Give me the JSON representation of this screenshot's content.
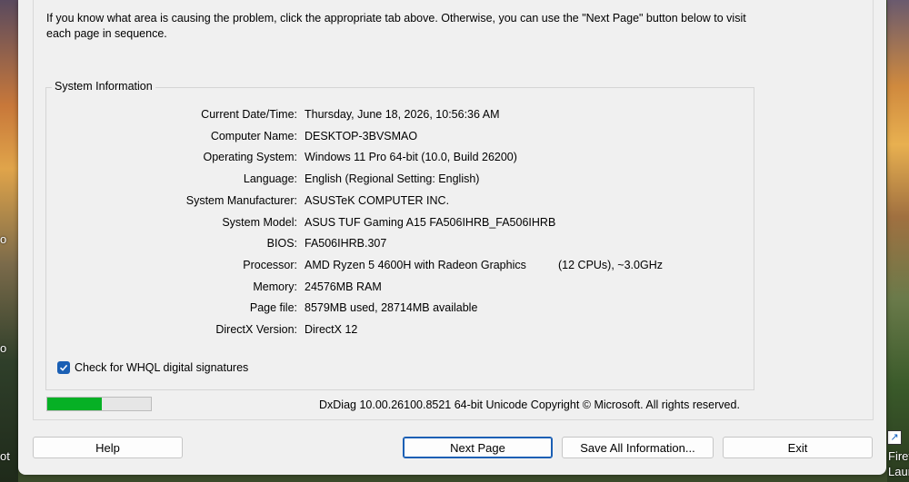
{
  "intro_text": "If you know what area is causing the problem, click the appropriate tab above.  Otherwise, you can use the \"Next Page\" button below to visit each page in sequence.",
  "system_info": {
    "title": "System Information",
    "rows": [
      {
        "label": "Current Date/Time:",
        "value": "Thursday, June 18, 2026, 10:56:36 AM"
      },
      {
        "label": "Computer Name:",
        "value": "DESKTOP-3BVSMAO"
      },
      {
        "label": "Operating System:",
        "value": "Windows 11 Pro 64-bit (10.0, Build 26200)"
      },
      {
        "label": "Language:",
        "value": "English (Regional Setting: English)"
      },
      {
        "label": "System Manufacturer:",
        "value": "ASUSTeK COMPUTER INC."
      },
      {
        "label": "System Model:",
        "value": "ASUS TUF Gaming A15 FA506IHRB_FA506IHRB"
      },
      {
        "label": "BIOS:",
        "value": "FA506IHRB.307"
      },
      {
        "label": "Processor:",
        "value": "AMD Ryzen 5 4600H with Radeon Graphics",
        "value2": "(12 CPUs), ~3.0GHz"
      },
      {
        "label": "Memory:",
        "value": "24576MB RAM"
      },
      {
        "label": "Page file:",
        "value": "8579MB used, 28714MB available"
      },
      {
        "label": "DirectX Version:",
        "value": "DirectX 12"
      }
    ]
  },
  "whql_checkbox": {
    "label": "Check for WHQL digital signatures",
    "checked": true
  },
  "progress": {
    "fraction": 0.53,
    "color": "#06b025"
  },
  "copyright": "DxDiag 10.00.26100.8521 64-bit Unicode  Copyright © Microsoft. All rights reserved.",
  "buttons": {
    "help": "Help",
    "next_page": "Next Page",
    "save_all": "Save All Information...",
    "exit": "Exit"
  },
  "desktop": {
    "right_label_1": "Firef",
    "right_label_2": "Laun"
  }
}
